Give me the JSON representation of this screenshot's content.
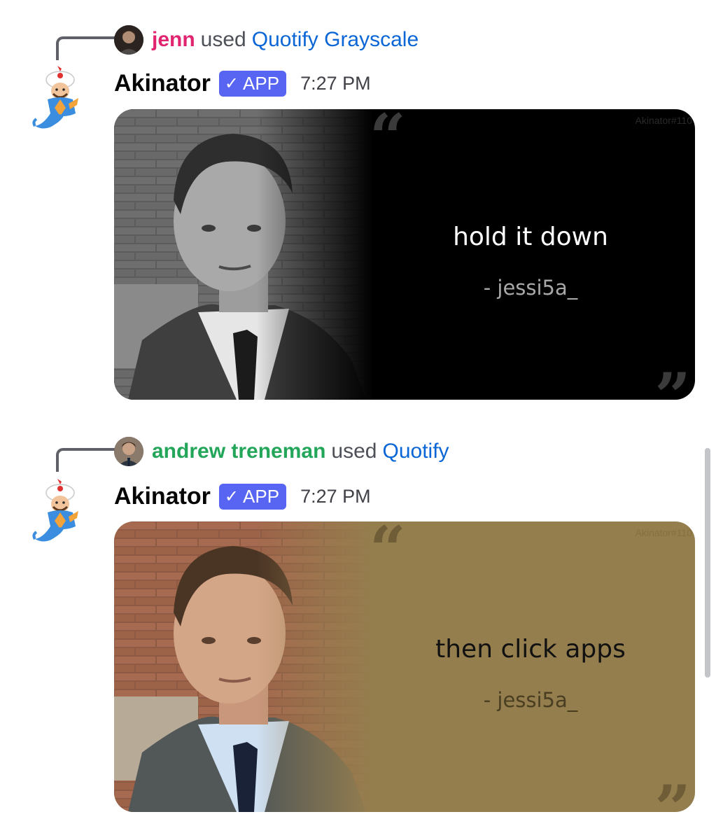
{
  "messages": [
    {
      "reply": {
        "username": "jenn",
        "username_color": "#e0246f",
        "used_text": "used",
        "command": "Quotify Grayscale"
      },
      "bot_name": "Akinator",
      "badge": {
        "check": "✓",
        "label": "APP"
      },
      "timestamp": "7:27 PM",
      "quote": {
        "text": "hold it down",
        "author": "- jessi5a_",
        "open_mark": "“",
        "close_mark": "”",
        "watermark": "Akinator#110",
        "background": "#000000",
        "text_color": "#ffffff",
        "author_color": "#a8a8a8",
        "mark_color": "#3a3a3a",
        "style": "grayscale"
      }
    },
    {
      "reply": {
        "username": "andrew treneman",
        "username_color": "#23a55a",
        "used_text": "used",
        "command": "Quotify"
      },
      "bot_name": "Akinator",
      "badge": {
        "check": "✓",
        "label": "APP"
      },
      "timestamp": "7:27 PM",
      "quote": {
        "text": "then click apps",
        "author": "- jessi5a_",
        "open_mark": "“",
        "close_mark": "”",
        "watermark": "Akinator#110",
        "background": "#957e4e",
        "text_color": "#111111",
        "author_color": "#4a3e22",
        "mark_color": "#6f5d37",
        "style": "color"
      }
    }
  ]
}
